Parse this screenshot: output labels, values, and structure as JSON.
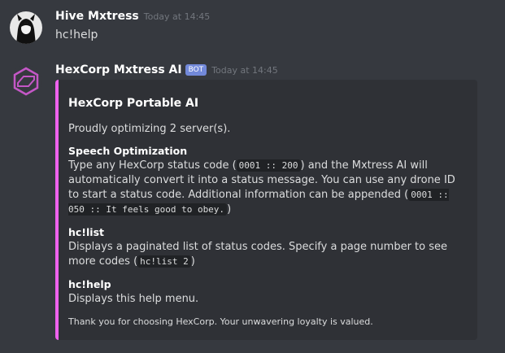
{
  "message1": {
    "username": "Hive Mxtress",
    "timestamp": "Today at 14:45",
    "content": "hc!help"
  },
  "message2": {
    "username": "HexCorp Mxtress AI",
    "bot_tag": "BOT",
    "timestamp": "Today at 14:45",
    "embed": {
      "accent_color": "#ef62ee",
      "title": "HexCorp Portable AI",
      "description": "Proudly optimizing 2 server(s).",
      "fields": [
        {
          "name": "Speech Optimization",
          "text1": "Type any HexCorp status code (",
          "code1": "0001 :: 200",
          "text2": ") and the Mxtress AI will automatically convert it into a status message. You can use any drone ID to start a status code. Additional information can be appended (",
          "code2": "0001 :: 050 :: It feels good to obey.",
          "text3": ")"
        },
        {
          "name": "hc!list",
          "text1": "Displays a paginated list of status codes. Specify a page number to see more codes (",
          "code1": "hc!list 2",
          "text2": ")"
        },
        {
          "name": "hc!help",
          "text1": "Displays this help menu."
        }
      ],
      "footer": "Thank you for choosing HexCorp. Your unwavering loyalty is valued."
    }
  }
}
